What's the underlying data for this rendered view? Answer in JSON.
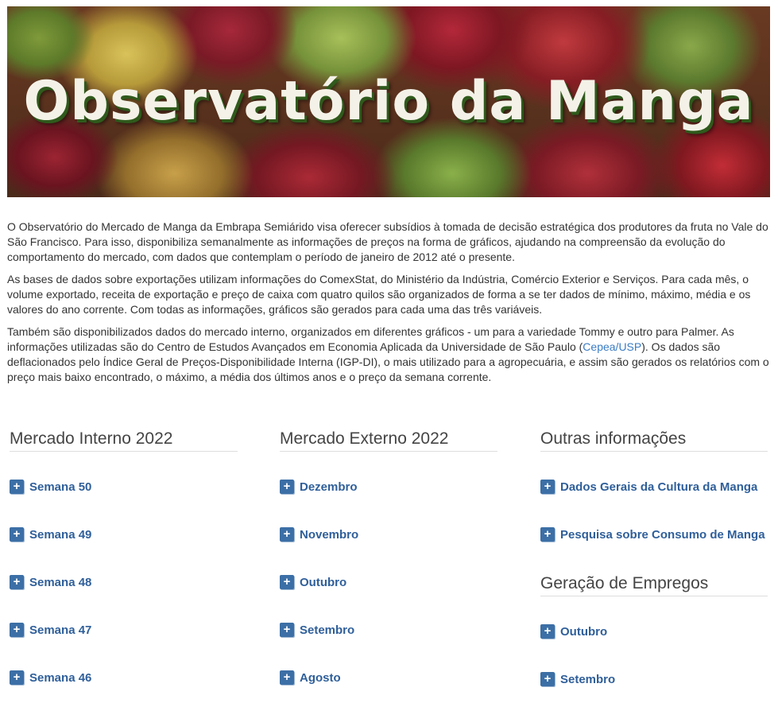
{
  "banner": {
    "title": "Observatório da Manga"
  },
  "intro": {
    "p1": "O Observatório do Mercado de Manga da Embrapa Semiárido visa oferecer subsídios à tomada de decisão estratégica dos produtores da fruta no Vale do São Francisco. Para isso, disponibiliza semanalmente as informações de preços na forma de gráficos, ajudando na compreensão da evolução do comportamento do mercado, com dados que contemplam o período de janeiro de 2012 até o presente.",
    "p2": "As bases de dados sobre exportações utilizam informações do ComexStat, do Ministério da Indústria, Comércio Exterior e Serviços. Para cada mês, o volume exportado, receita de exportação e preço de caixa com quatro quilos são organizados de forma a se ter dados de mínimo, máximo, média e os valores do ano corrente. Com todas as informações, gráficos são gerados para cada uma das três variáveis.",
    "p3_before": "Também são disponibilizados dados do mercado interno, organizados em diferentes gráficos - um para a variedade Tommy e outro para Palmer.  As informações utilizadas são do Centro de Estudos Avançados em Economia Aplicada da Universidade de São Paulo (",
    "p3_link": "Cepea/USP",
    "p3_after": "). Os dados são deflacionados pelo Índice Geral de Preços-Disponibilidade Interna (IGP-DI), o mais utilizado para a agropecuária, e assim são gerados os relatórios com o preço mais baixo encontrado, o máximo, a média dos últimos anos e o preço da semana corrente."
  },
  "mercado_interno": {
    "heading": "Mercado Interno 2022",
    "items": [
      "Semana 50",
      "Semana 49",
      "Semana 48",
      "Semana 47",
      "Semana 46"
    ]
  },
  "mercado_externo": {
    "heading": "Mercado Externo 2022",
    "items": [
      "Dezembro",
      "Novembro",
      "Outubro",
      "Setembro",
      "Agosto"
    ]
  },
  "outras": {
    "heading": "Outras informações",
    "items": [
      "Dados Gerais da Cultura da Manga",
      "Pesquisa sobre Consumo de Manga"
    ]
  },
  "empregos": {
    "heading": "Geração de Empregos",
    "items": [
      "Outubro",
      "Setembro"
    ]
  },
  "icons": {
    "link_icon": "plus-square-icon"
  },
  "colors": {
    "link": "#2f5f9a",
    "icon_bg": "#3c6fa6",
    "inline_link": "#3a7cc4"
  }
}
